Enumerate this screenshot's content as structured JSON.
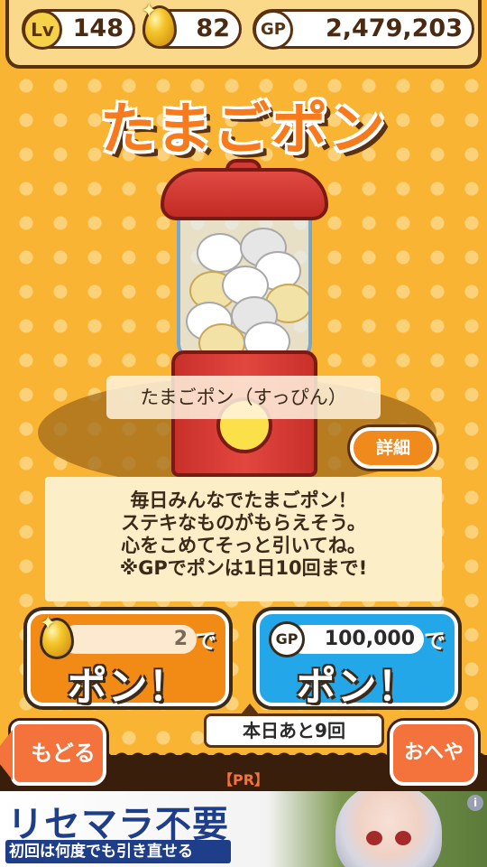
{
  "status_bar": {
    "level_badge": "Lv",
    "level": "148",
    "gold_eggs": "82",
    "gp_badge": "GP",
    "gp": "2,479,203"
  },
  "title": "たまごポン",
  "machine": {
    "name": "たまごポン（すっぴん）",
    "detail_label": "詳細"
  },
  "description": [
    "毎日みんなでたまごポン！",
    "ステキなものがもらえそう。",
    "心をこめてそっと引いてね。",
    "※GPでポンは1日10回まで!"
  ],
  "buttons": {
    "egg_pon": {
      "cost": "2",
      "suffix": "で",
      "label": "ポン！"
    },
    "gp_pon": {
      "badge": "GP",
      "cost": "100,000",
      "suffix": "で",
      "label": "ポン！"
    }
  },
  "remaining": "本日あと9回",
  "nav": {
    "back_label": "もどる",
    "room_label": "おへや"
  },
  "pr_label": "【PR】",
  "ad": {
    "title": "リセマラ不要",
    "subtitle": "初回は何度でも引き直せる",
    "info": "i"
  },
  "colors": {
    "background": "#f9b433",
    "accent_orange": "#f28a16",
    "gp_blue": "#23a7e8",
    "machine_red": "#d33a33"
  }
}
